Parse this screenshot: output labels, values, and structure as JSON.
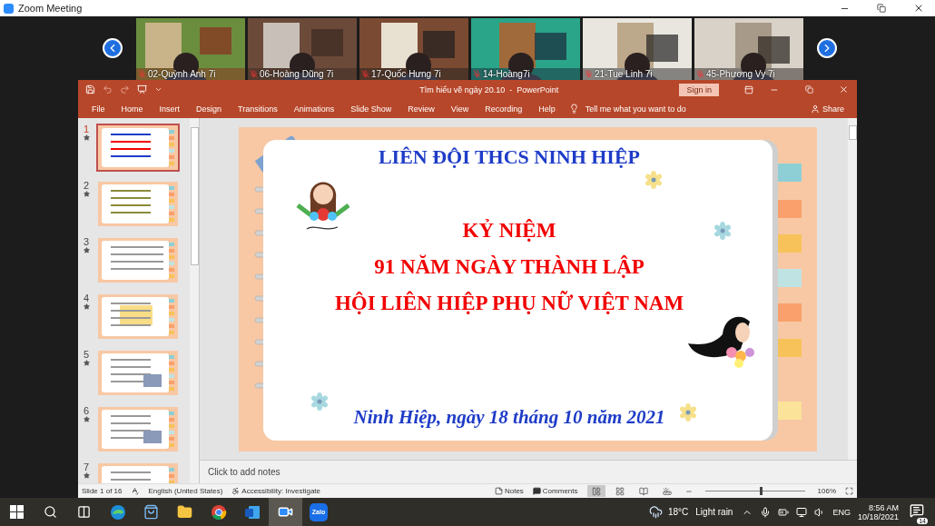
{
  "zoom_window": {
    "title": "Zoom Meeting"
  },
  "participants": [
    {
      "name": "02-Quỳnh Anh 7i",
      "muted": true
    },
    {
      "name": "06-Hoàng Dũng 7i",
      "muted": true
    },
    {
      "name": "17-Quốc Hưng 7i",
      "muted": true
    },
    {
      "name": "14-Hoàng7i",
      "muted": true
    },
    {
      "name": "21-Tue Linh 7i",
      "muted": true
    },
    {
      "name": "45-Phương Vy 7i",
      "muted": true
    }
  ],
  "powerpoint": {
    "title": "Tìm hiểu về ngày 20.10  -  PowerPoint",
    "sign_in": "Sign in",
    "tabs": [
      "File",
      "Home",
      "Insert",
      "Design",
      "Transitions",
      "Animations",
      "Slide Show",
      "Review",
      "View",
      "Recording",
      "Help"
    ],
    "tell_me": "Tell me what you want to do",
    "share": "Share"
  },
  "thumbnails": [
    {
      "number": "1",
      "selected": true
    },
    {
      "number": "2",
      "selected": false
    },
    {
      "number": "3",
      "selected": false
    },
    {
      "number": "4",
      "selected": false
    },
    {
      "number": "5",
      "selected": false
    },
    {
      "number": "6",
      "selected": false
    },
    {
      "number": "7",
      "selected": false
    }
  ],
  "slide": {
    "heading": "LIÊN ĐỘI THCS NINH HIỆP",
    "title_lines": [
      "KỶ NIỆM",
      "91 NĂM NGÀY THÀNH LẬP",
      "HỘI LIÊN HIỆP PHỤ NỮ VIỆT NAM"
    ],
    "date_line": "Ninh Hiệp, ngày 18 tháng 10 năm 2021"
  },
  "notes": {
    "placeholder": "Click to add notes"
  },
  "status_bar": {
    "slide_position": "Slide 1 of 16",
    "language": "English (United States)",
    "accessibility": "Accessibility: Investigate",
    "notes": "Notes",
    "comments": "Comments",
    "views": [
      {
        "kind": "normal",
        "selected": true
      },
      {
        "kind": "sorter",
        "selected": false
      },
      {
        "kind": "reading",
        "selected": false
      },
      {
        "kind": "slideshow",
        "selected": false
      }
    ],
    "zoom": {
      "level": 0.55,
      "reading": "106%"
    }
  },
  "taskbar": {
    "apps": [
      {
        "kind": "edge",
        "active": false
      },
      {
        "kind": "store",
        "active": false
      },
      {
        "kind": "explorer",
        "active": false
      },
      {
        "kind": "chrome",
        "active": false
      },
      {
        "kind": "word",
        "active": false
      },
      {
        "kind": "zoom",
        "active": true
      },
      {
        "kind": "zalo",
        "label": "Zalo",
        "active": false
      }
    ],
    "temperature": "18°C",
    "condition": "Light rain",
    "language": "ENG",
    "time": "8:56 AM",
    "date": "10/18/2021",
    "notifications": "14"
  }
}
